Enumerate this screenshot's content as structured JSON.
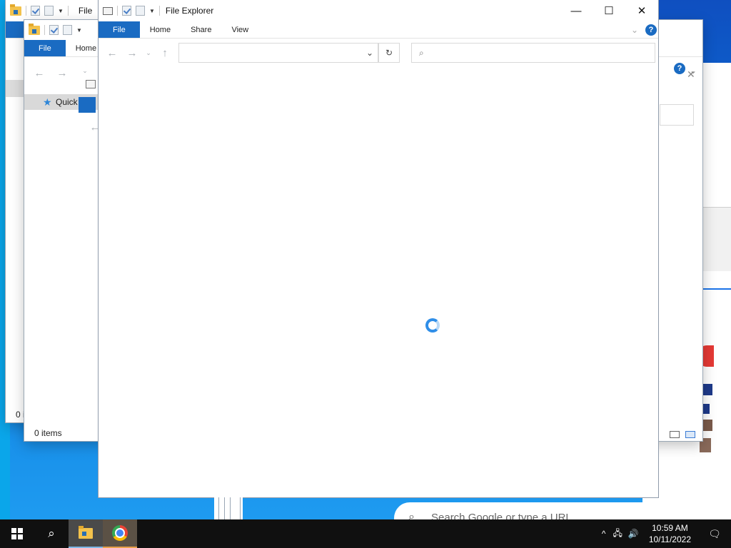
{
  "explorer": {
    "title": "File Explorer",
    "tabs": {
      "file": "File",
      "home": "Home",
      "share": "Share",
      "view": "View"
    },
    "help": "?",
    "status_items": "0 items",
    "sidebar_quick": "Quick",
    "title_partial": "File",
    "status_partial": "0 i"
  },
  "chrome": {
    "omnibox_placeholder": "Search Google or type a URL"
  },
  "taskbar": {
    "time": "10:59 AM",
    "date": "10/11/2022"
  },
  "icons": {
    "minimize": "—",
    "maximize": "☐",
    "close": "✕",
    "back": "←",
    "forward": "→",
    "up": "↑",
    "refresh": "↻",
    "chevron": "⌄",
    "search": "⌕",
    "tray_up": "^",
    "network": "🖧",
    "volume": "🔊",
    "notification": "🗨"
  }
}
